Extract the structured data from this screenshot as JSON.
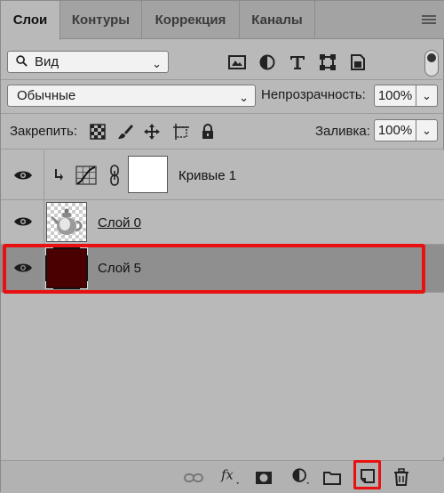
{
  "tabs": [
    {
      "label": "Слои",
      "active": true
    },
    {
      "label": "Контуры",
      "active": false
    },
    {
      "label": "Коррекция",
      "active": false
    },
    {
      "label": "Каналы",
      "active": false
    }
  ],
  "filter": {
    "kind_label": "Вид"
  },
  "blend_mode": "Обычные",
  "opacity": {
    "label": "Непрозрачность:",
    "value": "100%"
  },
  "lock": {
    "label": "Закрепить:"
  },
  "fill": {
    "label": "Заливка:",
    "value": "100%"
  },
  "layers": [
    {
      "name": "Кривые 1",
      "type": "adjustment-curves",
      "visible": true,
      "clipped": true
    },
    {
      "name": "Слой 0",
      "type": "pixel",
      "visible": true,
      "underlined": true
    },
    {
      "name": "Слой 5",
      "type": "pixel",
      "visible": true,
      "selected": true,
      "fill_color": "#4a0000"
    }
  ],
  "colors": {
    "highlight": "#e81010",
    "selected_row": "#8f8f8f",
    "panel": "#b9b9b9"
  }
}
